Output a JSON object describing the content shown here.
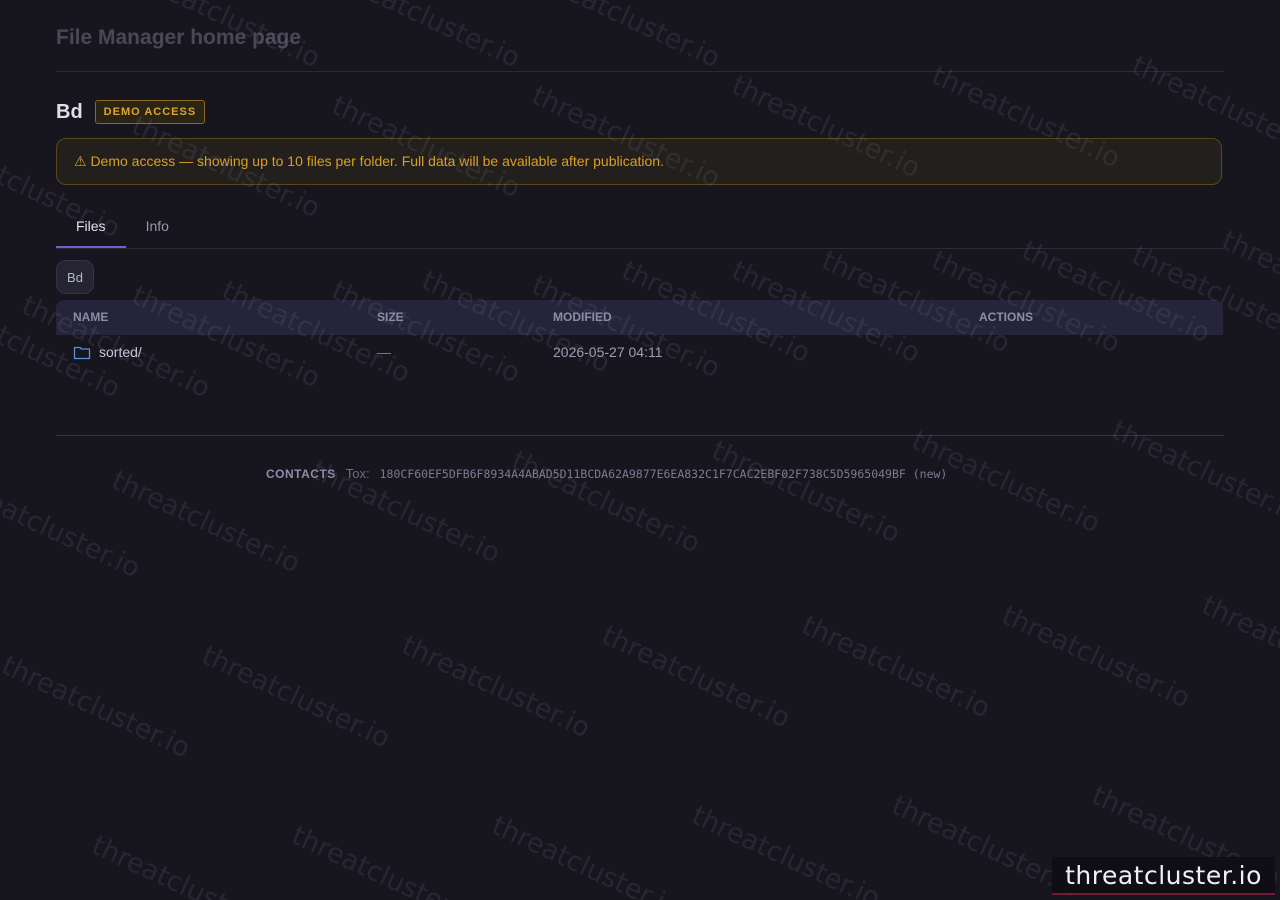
{
  "page_title": "File Manager home page",
  "folder": {
    "name": "Bd",
    "badge": "DEMO ACCESS"
  },
  "alert": {
    "icon": "warning-icon",
    "text": "⚠ Demo access — showing up to 10 files per folder. Full data will be available after publication."
  },
  "tabs": [
    {
      "label": "Files",
      "active": true
    },
    {
      "label": "Info",
      "active": false
    }
  ],
  "breadcrumb": {
    "items": [
      "Bd"
    ]
  },
  "table": {
    "columns": [
      "NAME",
      "SIZE",
      "MODIFIED",
      "ACTIONS"
    ],
    "rows": [
      {
        "icon": "folder-icon",
        "name": "sorted/",
        "size": "—",
        "modified": "2026-05-27 04:11",
        "actions": ""
      }
    ]
  },
  "contacts": {
    "label": "CONTACTS",
    "type": "Tox:",
    "value": "180CF60EF5DFB6F8934A4ABAD5D11BCDA62A9877E6EA832C1F7CAC2EBF02F738C5D5965049BF (new)"
  },
  "watermark_text": "threatcluster.io",
  "brand_logo": "threatcluster.io",
  "colors": {
    "background": "#17161f",
    "accent": "#7a5ccc",
    "warning": "#d9a020",
    "folder_icon": "#5b8fd8"
  }
}
